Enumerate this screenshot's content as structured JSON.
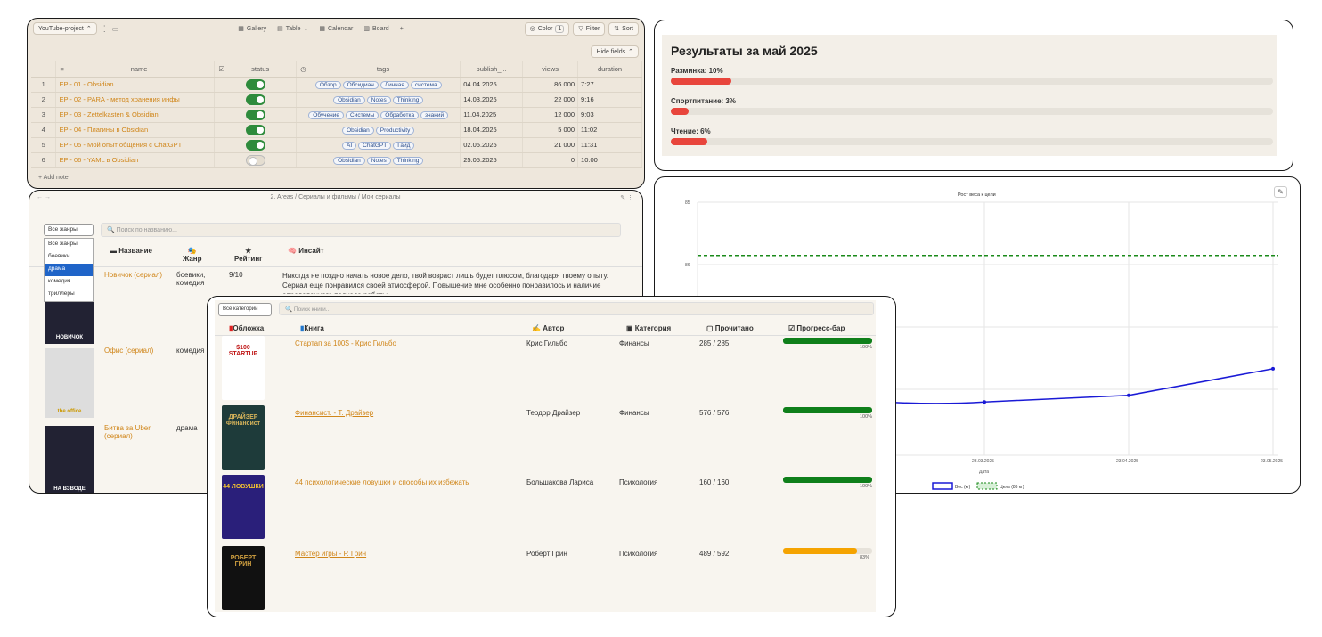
{
  "db": {
    "project": "YouTube-project",
    "views": [
      "Gallery",
      "Table",
      "Calendar",
      "Board"
    ],
    "controls": {
      "color": "Color",
      "color_count": "1",
      "filter": "Filter",
      "sort": "Sort",
      "hide": "Hide fields"
    },
    "columns": [
      "name",
      "status",
      "tags",
      "publish_...",
      "views",
      "duration"
    ],
    "rows": [
      {
        "n": "1",
        "name": "EP - 01 - Obsidian",
        "on": true,
        "tags": [
          "Обзор",
          "Обсидиан",
          "Личная",
          "система"
        ],
        "date": "04.04.2025",
        "views": "86 000",
        "dur": "7:27",
        "flag": false
      },
      {
        "n": "2",
        "name": "EP - 02 - PARA - метод хранения инфы",
        "on": true,
        "tags": [
          "Obsidian",
          "Notes",
          "Thinking"
        ],
        "date": "14.03.2025",
        "views": "22 000",
        "dur": "9:16",
        "flag": false
      },
      {
        "n": "3",
        "name": "EP - 03 - Zettelkasten & Obsidian",
        "on": true,
        "tags": [
          "Обучение",
          "Системы",
          "Обработка",
          "знаний"
        ],
        "date": "11.04.2025",
        "views": "12 000",
        "dur": "9:03",
        "flag": false
      },
      {
        "n": "4",
        "name": "EP - 04 - Плагины в Obsidian",
        "on": true,
        "tags": [
          "Obsidian",
          "Productivity"
        ],
        "date": "18.04.2025",
        "views": "5 000",
        "dur": "11:02",
        "flag": true
      },
      {
        "n": "5",
        "name": "EP - 05 - Мой опыт общения с ChatGPT",
        "on": true,
        "tags": [
          "AI",
          "ChatGPT",
          "Гайд"
        ],
        "date": "02.05.2025",
        "views": "21 000",
        "dur": "11:31",
        "flag": false
      },
      {
        "n": "6",
        "name": "EP - 06 - YAML в Obsidian",
        "on": false,
        "tags": [
          "Obsidian",
          "Notes",
          "Thinking"
        ],
        "date": "25.05.2025",
        "views": "0",
        "dur": "10:00",
        "flag": true
      }
    ],
    "add_note": "+ Add note"
  },
  "results": {
    "title": "Результаты за май 2025",
    "bars": [
      {
        "label": "Разминка: 10%",
        "value": 0.1
      },
      {
        "label": "Спортпитание: 3%",
        "value": 0.03
      },
      {
        "label": "Чтение: 6%",
        "value": 0.06
      }
    ]
  },
  "chart_data": {
    "type": "line",
    "title": "Рост веса к цели",
    "xlabel": "Дата",
    "x_ticks": [
      "23.03.2025",
      "23.04.2025",
      "23.05.2025"
    ],
    "y_ticks": [
      "85",
      "86"
    ],
    "series": [
      {
        "name": "Вес (кг)",
        "color": "#1a1ad6",
        "points": [
          [
            "23.03.2025",
            84.9
          ],
          [
            "23.04.2025",
            84.95
          ],
          [
            "23.05.2025",
            85.15
          ]
        ]
      },
      {
        "name": "Цель (86 кг)",
        "color": "#1a8a1a",
        "dashed": true,
        "value": 86
      }
    ]
  },
  "series_db": {
    "crumb": "2. Areas / Сериалы и фильмы / Мои сериалы",
    "filter": "Все жанры",
    "search": "Поиск по названию...",
    "genres": [
      "Все жанры",
      "боевики",
      "драма",
      "комедия",
      "триллеры"
    ],
    "headers": [
      "Название",
      "Жанр",
      "Рейтинг",
      "Инсайт"
    ],
    "items": [
      {
        "title": "Новичок (сериал)",
        "genre": "боевики, комедия",
        "rating": "9/10",
        "insight": "Никогда не поздно начать новое дело, твой возраст лишь будет плюсом, благодаря твоему опыту. Сериал еще понравился своей атмосферой. Повышение мне особенно понравилось и наличие определенного подхода работы.",
        "poster": "НОВИЧОК"
      },
      {
        "title": "Офис (сериал)",
        "genre": "комедия",
        "poster": "the office"
      },
      {
        "title": "Битва за Uber (сериал)",
        "genre": "драма",
        "poster": "НА ВЗВОДЕ"
      }
    ]
  },
  "books": {
    "category": "Все категории",
    "search": "Поиск книги...",
    "headers": [
      "Обложка",
      "Книга",
      "Автор",
      "Категория",
      "Прочитано",
      "Прогресс-бар"
    ],
    "items": [
      {
        "title": "Стартап за 100$ - Крис Гильбо",
        "author": "Крис Гильбо",
        "cat": "Финансы",
        "read": "285 / 285",
        "p": 1.0,
        "pct": "100%",
        "color": "#0f7f1a",
        "cover": "$100 STARTUP"
      },
      {
        "title": "Финансист. - Т. Драйзер",
        "author": "Теодор Драйзер",
        "cat": "Финансы",
        "read": "576 / 576",
        "p": 1.0,
        "pct": "100%",
        "color": "#0f7f1a",
        "cover": "ДРАЙЗЕР Финансист"
      },
      {
        "title": "44 психологические ловушки и способы их избежать",
        "author": "Большакова Лариса",
        "cat": "Психология",
        "read": "160 / 160",
        "p": 1.0,
        "pct": "100%",
        "color": "#0f7f1a",
        "cover": "44 ЛОВУШКИ"
      },
      {
        "title": "Мастер игры - Р. Грин",
        "author": "Роберт Грин",
        "cat": "Психология",
        "read": "489 / 592",
        "p": 0.83,
        "pct": "83%",
        "color": "#f5a300",
        "cover": "РОБЕРТ ГРИН"
      }
    ]
  }
}
